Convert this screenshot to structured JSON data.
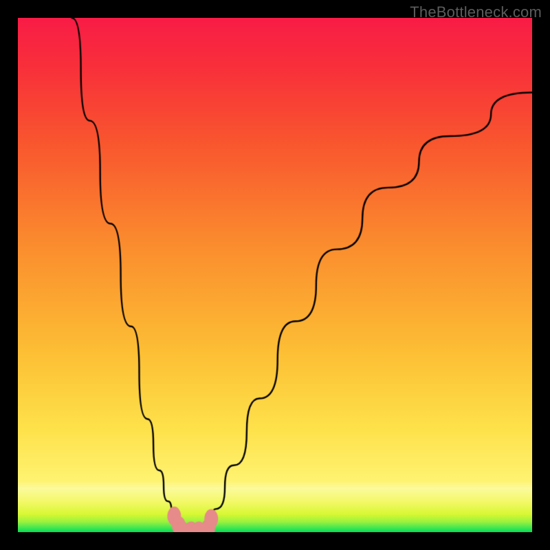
{
  "watermark": "TheBottleneck.com",
  "chart_data": {
    "type": "line",
    "title": "",
    "xlabel": "",
    "ylabel": "",
    "xlim": [
      0,
      100
    ],
    "ylim": [
      0,
      100
    ],
    "series": [
      {
        "name": "curve-left",
        "x": [
          10.5,
          14,
          18,
          22,
          25.2,
          27.5,
          29.2,
          30.5,
          31.4,
          32.0
        ],
        "values": [
          100,
          80,
          60,
          40,
          22,
          12,
          6,
          2.6,
          1,
          0
        ]
      },
      {
        "name": "curve-right",
        "x": [
          36.8,
          38.5,
          42,
          47,
          54,
          62,
          72,
          84,
          100
        ],
        "values": [
          0,
          4.5,
          13,
          26,
          41,
          55,
          67,
          77,
          85.5
        ]
      }
    ],
    "markers": {
      "name": "highlight-dots",
      "points": [
        {
          "x": 30.4,
          "y": 3.1
        },
        {
          "x": 31.3,
          "y": 1.2
        },
        {
          "x": 32.0,
          "y": 0.2
        },
        {
          "x": 33.7,
          "y": 0.2
        },
        {
          "x": 35.2,
          "y": 0.2
        },
        {
          "x": 37.0,
          "y": 0.7
        },
        {
          "x": 37.6,
          "y": 2.6
        }
      ]
    },
    "gradient_bands": [
      {
        "stop": 0.0,
        "color": "#00e05a"
      },
      {
        "stop": 0.01,
        "color": "#4fe84f"
      },
      {
        "stop": 0.02,
        "color": "#9af23e"
      },
      {
        "stop": 0.035,
        "color": "#d8f834"
      },
      {
        "stop": 0.06,
        "color": "#f4f86a"
      },
      {
        "stop": 0.085,
        "color": "#fcfb9c"
      },
      {
        "stop": 0.1,
        "color": "#fef371"
      },
      {
        "stop": 0.2,
        "color": "#fee24b"
      },
      {
        "stop": 0.35,
        "color": "#fdbf35"
      },
      {
        "stop": 0.55,
        "color": "#fb8f2e"
      },
      {
        "stop": 0.75,
        "color": "#f9582e"
      },
      {
        "stop": 0.9,
        "color": "#f8313a"
      },
      {
        "stop": 1.0,
        "color": "#f81c46"
      }
    ],
    "style": {
      "line_color": "#000000",
      "line_width": 2.4,
      "marker_fill": "#e78a8a",
      "marker_stroke": "#e78a8a",
      "marker_radius_x": 10,
      "marker_radius_y": 14
    }
  }
}
